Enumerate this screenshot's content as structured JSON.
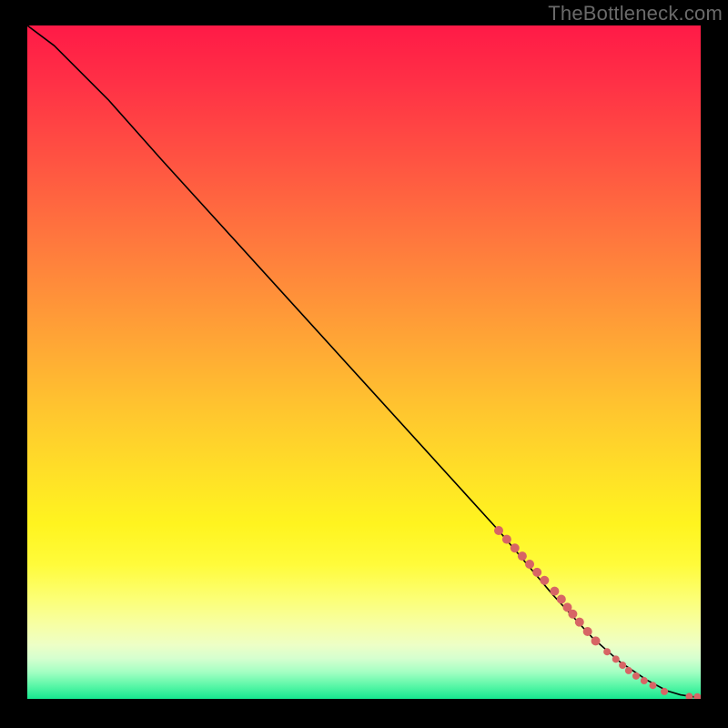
{
  "watermark": "TheBottleneck.com",
  "chart_data": {
    "type": "line",
    "title": "",
    "xlabel": "",
    "ylabel": "",
    "xlim": [
      0,
      100
    ],
    "ylim": [
      0,
      100
    ],
    "curve": [
      {
        "x": 0,
        "y": 100
      },
      {
        "x": 4,
        "y": 97
      },
      {
        "x": 8,
        "y": 93
      },
      {
        "x": 12,
        "y": 89
      },
      {
        "x": 20,
        "y": 80
      },
      {
        "x": 30,
        "y": 69
      },
      {
        "x": 40,
        "y": 58
      },
      {
        "x": 50,
        "y": 47
      },
      {
        "x": 60,
        "y": 36
      },
      {
        "x": 70,
        "y": 25
      },
      {
        "x": 78,
        "y": 15.5
      },
      {
        "x": 84,
        "y": 9
      },
      {
        "x": 88,
        "y": 5.5
      },
      {
        "x": 92,
        "y": 2.8
      },
      {
        "x": 95,
        "y": 1.2
      },
      {
        "x": 97,
        "y": 0.6
      },
      {
        "x": 99,
        "y": 0.3
      },
      {
        "x": 100,
        "y": 0.3
      }
    ],
    "series": [
      {
        "name": "highlighted-points",
        "color": "#d76565",
        "points": [
          {
            "x": 70.0,
            "y": 25.0,
            "r": 5
          },
          {
            "x": 71.2,
            "y": 23.7,
            "r": 5
          },
          {
            "x": 72.4,
            "y": 22.4,
            "r": 5
          },
          {
            "x": 73.5,
            "y": 21.2,
            "r": 5
          },
          {
            "x": 74.6,
            "y": 20.0,
            "r": 5
          },
          {
            "x": 75.7,
            "y": 18.8,
            "r": 5
          },
          {
            "x": 76.8,
            "y": 17.6,
            "r": 5
          },
          {
            "x": 78.3,
            "y": 16.0,
            "r": 5
          },
          {
            "x": 79.3,
            "y": 14.8,
            "r": 5
          },
          {
            "x": 80.2,
            "y": 13.6,
            "r": 5
          },
          {
            "x": 81.0,
            "y": 12.6,
            "r": 5
          },
          {
            "x": 82.0,
            "y": 11.4,
            "r": 5
          },
          {
            "x": 83.2,
            "y": 10.0,
            "r": 5
          },
          {
            "x": 84.4,
            "y": 8.6,
            "r": 5
          },
          {
            "x": 86.1,
            "y": 7.0,
            "r": 4
          },
          {
            "x": 87.4,
            "y": 5.9,
            "r": 4
          },
          {
            "x": 88.4,
            "y": 5.0,
            "r": 4
          },
          {
            "x": 89.3,
            "y": 4.2,
            "r": 4
          },
          {
            "x": 90.4,
            "y": 3.4,
            "r": 4
          },
          {
            "x": 91.6,
            "y": 2.7,
            "r": 4
          },
          {
            "x": 92.9,
            "y": 2.0,
            "r": 4
          },
          {
            "x": 94.6,
            "y": 1.1,
            "r": 4
          },
          {
            "x": 98.3,
            "y": 0.35,
            "r": 4
          },
          {
            "x": 99.5,
            "y": 0.3,
            "r": 4
          }
        ]
      }
    ]
  }
}
